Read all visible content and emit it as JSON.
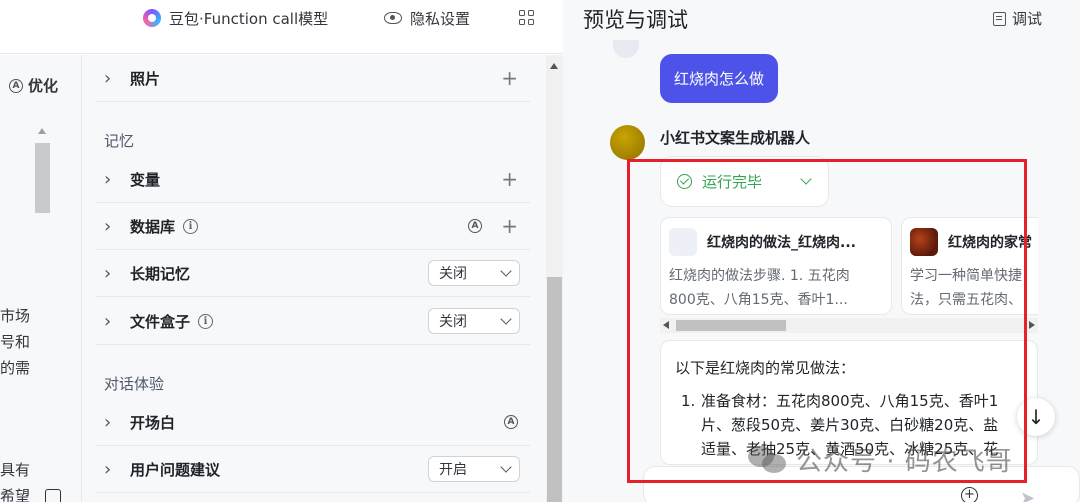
{
  "topbar": {
    "model_label": "豆包·Function call模型",
    "privacy_label": "隐私设置"
  },
  "left_strip": {
    "optimize_label": "优化",
    "circle_letter": "A",
    "fragments": [
      "市场",
      "号和",
      "的需",
      "具有",
      "希望"
    ]
  },
  "settings": {
    "photo_label": "照片",
    "memory_section": "记忆",
    "variable_label": "变量",
    "database_label": "数据库",
    "long_memory_label": "长期记忆",
    "long_memory_value": "关闭",
    "filebox_label": "文件盒子",
    "filebox_value": "关闭",
    "dialog_section": "对话体验",
    "opening_label": "开场白",
    "suggestion_label": "用户问题建议",
    "suggestion_value": "开启",
    "info_glyph": "i",
    "plus_glyph": "+",
    "chevron_glyph": "›"
  },
  "preview": {
    "title": "预览与调试",
    "debug_label": "调试",
    "user_message": "红烧肉怎么做",
    "bot_name": "小红书文案生成机器人",
    "status": "运行完毕",
    "cards": [
      {
        "title": "红烧肉的做法_红烧肉...",
        "line1": "红烧肉的做法步骤. 1. 五花肉",
        "line2": "800克、八角15克、香叶1..."
      },
      {
        "title": "红烧肉的家常",
        "line1": "学习一种简单快捷",
        "line2": "法，只需五花肉、"
      }
    ],
    "answer_intro": "以下是红烧肉的常见做法：",
    "answer_item_num": "1.",
    "answer_item_lines": [
      "准备食材：五花肉800克、八角15克、香叶1",
      "片、葱段50克、姜片30克、白砂糖20克、盐",
      "适量、老抽25克、黄酒50克、冰糖25克、花"
    ],
    "down_arrow": "↓",
    "add_glyph": "+",
    "send_glyph": "➤"
  },
  "watermark": {
    "text": "公众号 · 码农飞哥"
  }
}
